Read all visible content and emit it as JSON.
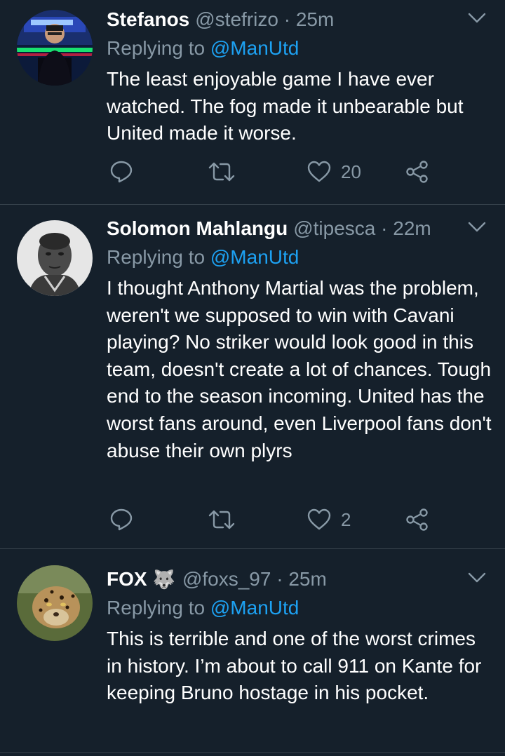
{
  "colors": {
    "background": "#15202b",
    "divider": "#38444d",
    "secondary_text": "#8899a6",
    "link": "#1da1f2"
  },
  "tweets": [
    {
      "name": "Stefanos",
      "handle": "@stefrizo",
      "time": "25m",
      "replying_prefix": "Replying to",
      "replying_to": "@ManUtd",
      "text": "The least enjoyable game I have ever watched. The fog made it unbearable but United made it worse.",
      "like_count": "20",
      "icons": [
        "reply-icon",
        "retweet-icon",
        "like-icon",
        "share-icon",
        "chevron-down-icon"
      ]
    },
    {
      "name": "Solomon Mahlangu",
      "handle": "@tipesca",
      "time": "22m",
      "replying_prefix": "Replying to",
      "replying_to": "@ManUtd",
      "text": "I thought Anthony Martial was the problem, weren't we supposed to win with Cavani playing? No striker would look good in this team, doesn't create a lot of chances. Tough end to the season incoming. United has the worst fans around, even Liverpool fans don't abuse their own plyrs",
      "like_count": "2",
      "icons": [
        "reply-icon",
        "retweet-icon",
        "like-icon",
        "share-icon",
        "chevron-down-icon"
      ]
    },
    {
      "name": "FOX",
      "name_emoji": "🐺",
      "handle": "@foxs_97",
      "time": "25m",
      "replying_prefix": "Replying to",
      "replying_to": "@ManUtd",
      "text": "This is terrible and one of the worst crimes in history. I’m about to call 911 on Kante for keeping Bruno hostage in his pocket.",
      "icons": [
        "chevron-down-icon"
      ]
    }
  ]
}
